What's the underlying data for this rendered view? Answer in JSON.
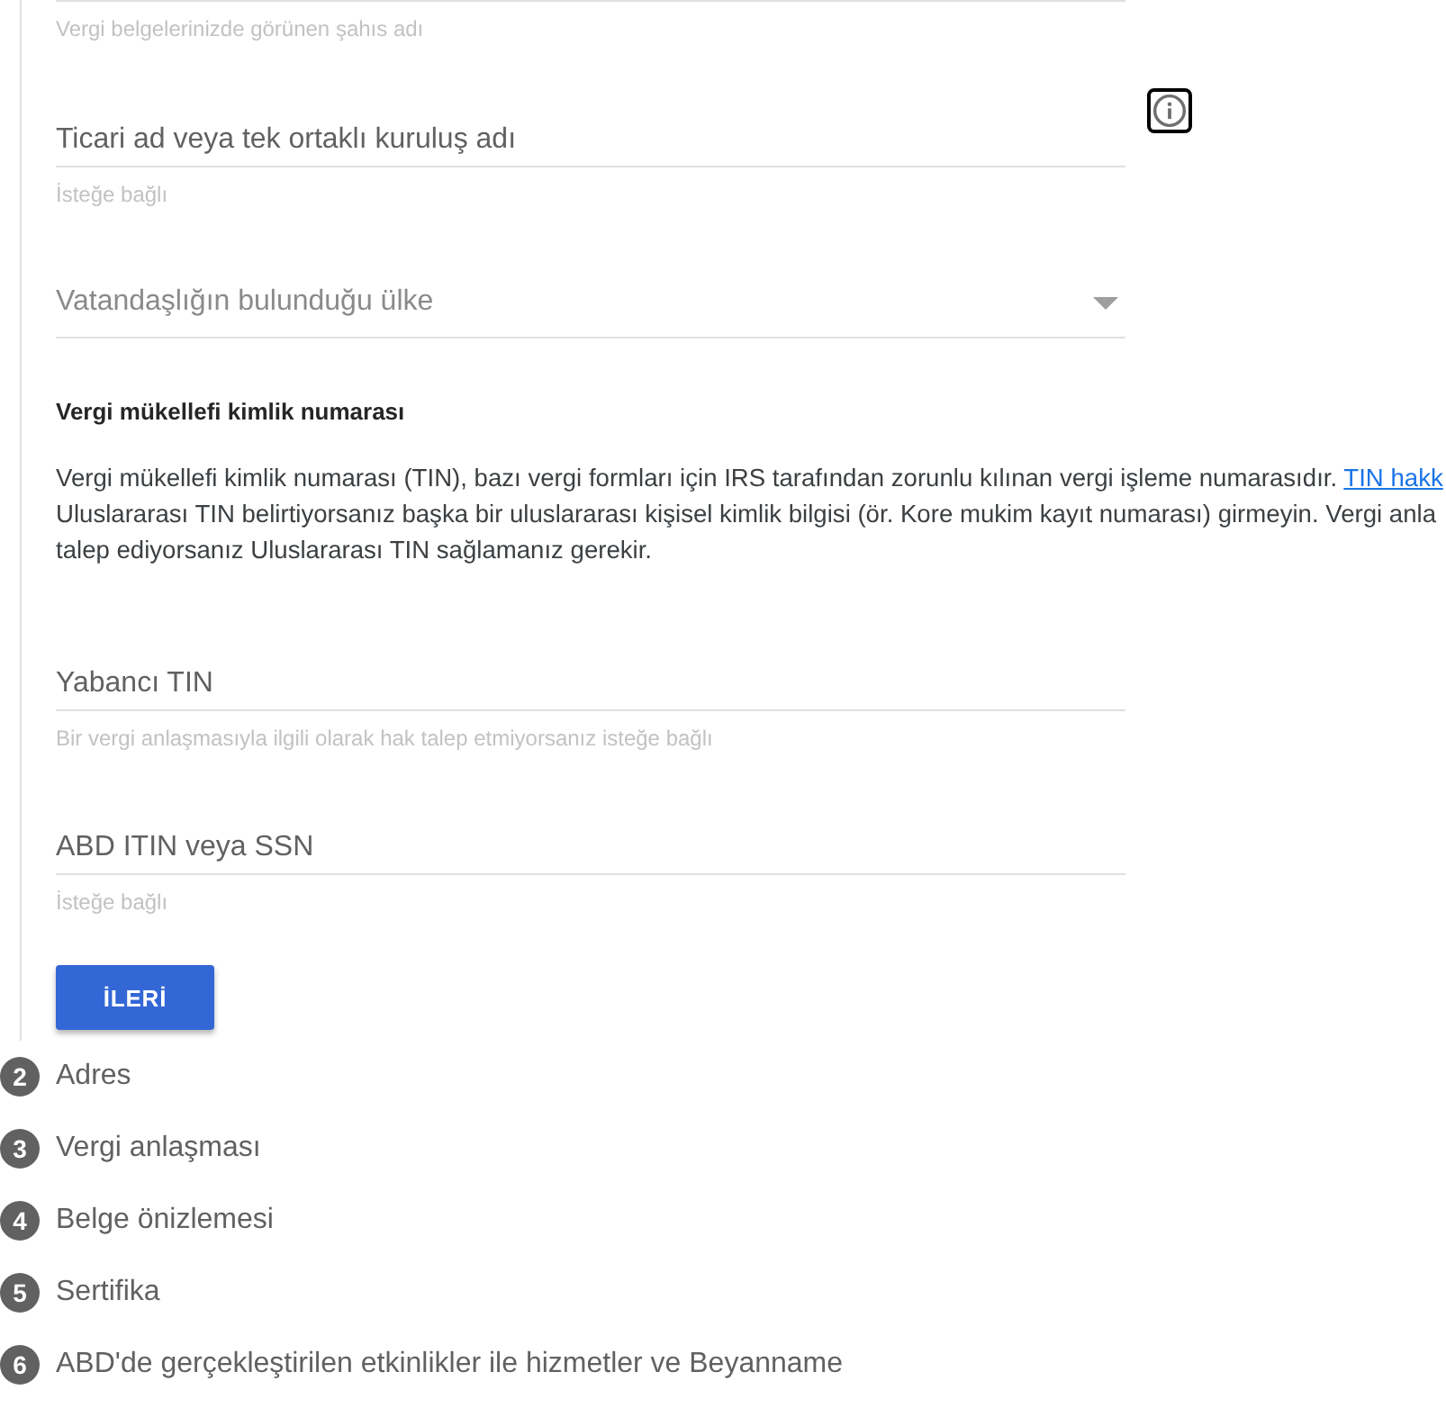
{
  "current_step": {
    "top_field_helper": "Vergi belgelerinizde görünen şahıs adı",
    "fields": [
      {
        "kind": "text",
        "placeholder": "Ticari ad veya tek ortaklı kuruluş adı",
        "helper": "İsteğe bağlı",
        "info_button": {
          "focused": true
        }
      },
      {
        "kind": "select",
        "placeholder": "Vatandaşlığın bulunduğu ülke"
      }
    ],
    "tin_section": {
      "heading": "Vergi mükellefi kimlik numarası",
      "lines": [
        "Vergi mükellefi kimlik numarası (TIN), bazı vergi formları için IRS tarafından zorunlu kılınan vergi işleme numarasıdır.",
        "Uluslararası TIN belirtiyorsanız başka bir uluslararası kişisel kimlik bilgisi (ör. Kore mukim kayıt numarası) girmeyin. Vergi anla",
        "talep ediyorsanız Uluslararası TIN sağlamanız gerekir."
      ],
      "link": "TIN hakk"
    },
    "tin_fields": [
      {
        "kind": "text",
        "placeholder": "Yabancı TIN",
        "helper": "Bir vergi anlaşmasıyla ilgili olarak hak talep etmiyorsanız isteğe bağlı"
      },
      {
        "kind": "text",
        "placeholder": "ABD ITIN veya SSN",
        "helper": "İsteğe bağlı"
      }
    ],
    "next_button": "İLERİ"
  },
  "steps": [
    {
      "number": "2",
      "label": "Adres"
    },
    {
      "number": "3",
      "label": "Vergi anlaşması"
    },
    {
      "number": "4",
      "label": "Belge önizlemesi"
    },
    {
      "number": "5",
      "label": "Sertifika"
    },
    {
      "number": "6",
      "label": "ABD'de gerçekleştirilen etkinlikler ile hizmetler ve Beyanname"
    }
  ]
}
